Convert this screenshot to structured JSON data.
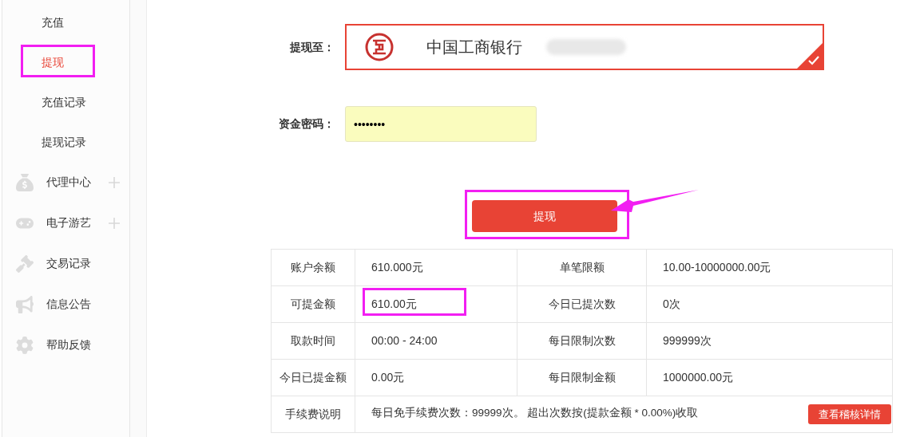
{
  "sidebar": {
    "items": [
      {
        "kind": "sub",
        "label": "充值",
        "selected": false
      },
      {
        "kind": "sub",
        "label": "提现",
        "selected": true
      },
      {
        "kind": "sub",
        "label": "充值记录",
        "selected": false
      },
      {
        "kind": "sub",
        "label": "提现记录",
        "selected": false
      },
      {
        "kind": "section",
        "label": "代理中心",
        "selected": false,
        "expandable": true
      },
      {
        "kind": "section",
        "label": "电子游艺",
        "selected": false,
        "expandable": true
      },
      {
        "kind": "section",
        "label": "交易记录",
        "selected": false,
        "expandable": false
      },
      {
        "kind": "section",
        "label": "信息公告",
        "selected": false,
        "expandable": false
      },
      {
        "kind": "section",
        "label": "帮助反馈",
        "selected": false,
        "expandable": false
      }
    ]
  },
  "form": {
    "bank_label": "提现至：",
    "bank_name": "中国工商银行",
    "bank_selected": true,
    "password_label": "资金密码：",
    "password_value": "••••••••",
    "submit": "提现"
  },
  "info_table": {
    "rows": [
      {
        "cells": [
          "账户余额",
          "610.000元",
          "单笔限额",
          "10.00-10000000.00元"
        ]
      },
      {
        "cells": [
          "可提金额",
          "610.00元",
          "今日已提次数",
          "0次"
        ]
      },
      {
        "cells": [
          "取款时间",
          "00:00 - 24:00",
          "每日限制次数",
          "999999次"
        ]
      },
      {
        "cells": [
          "今日已提金额",
          "0.00元",
          "每日限制金额",
          "1000000.00元"
        ]
      }
    ],
    "fee_row": {
      "label": "手续费说明",
      "text": "每日免手续费次数：99999次。 超出次数按(提款金额 * 0.00%)收取",
      "button": "查看稽核详情"
    }
  }
}
